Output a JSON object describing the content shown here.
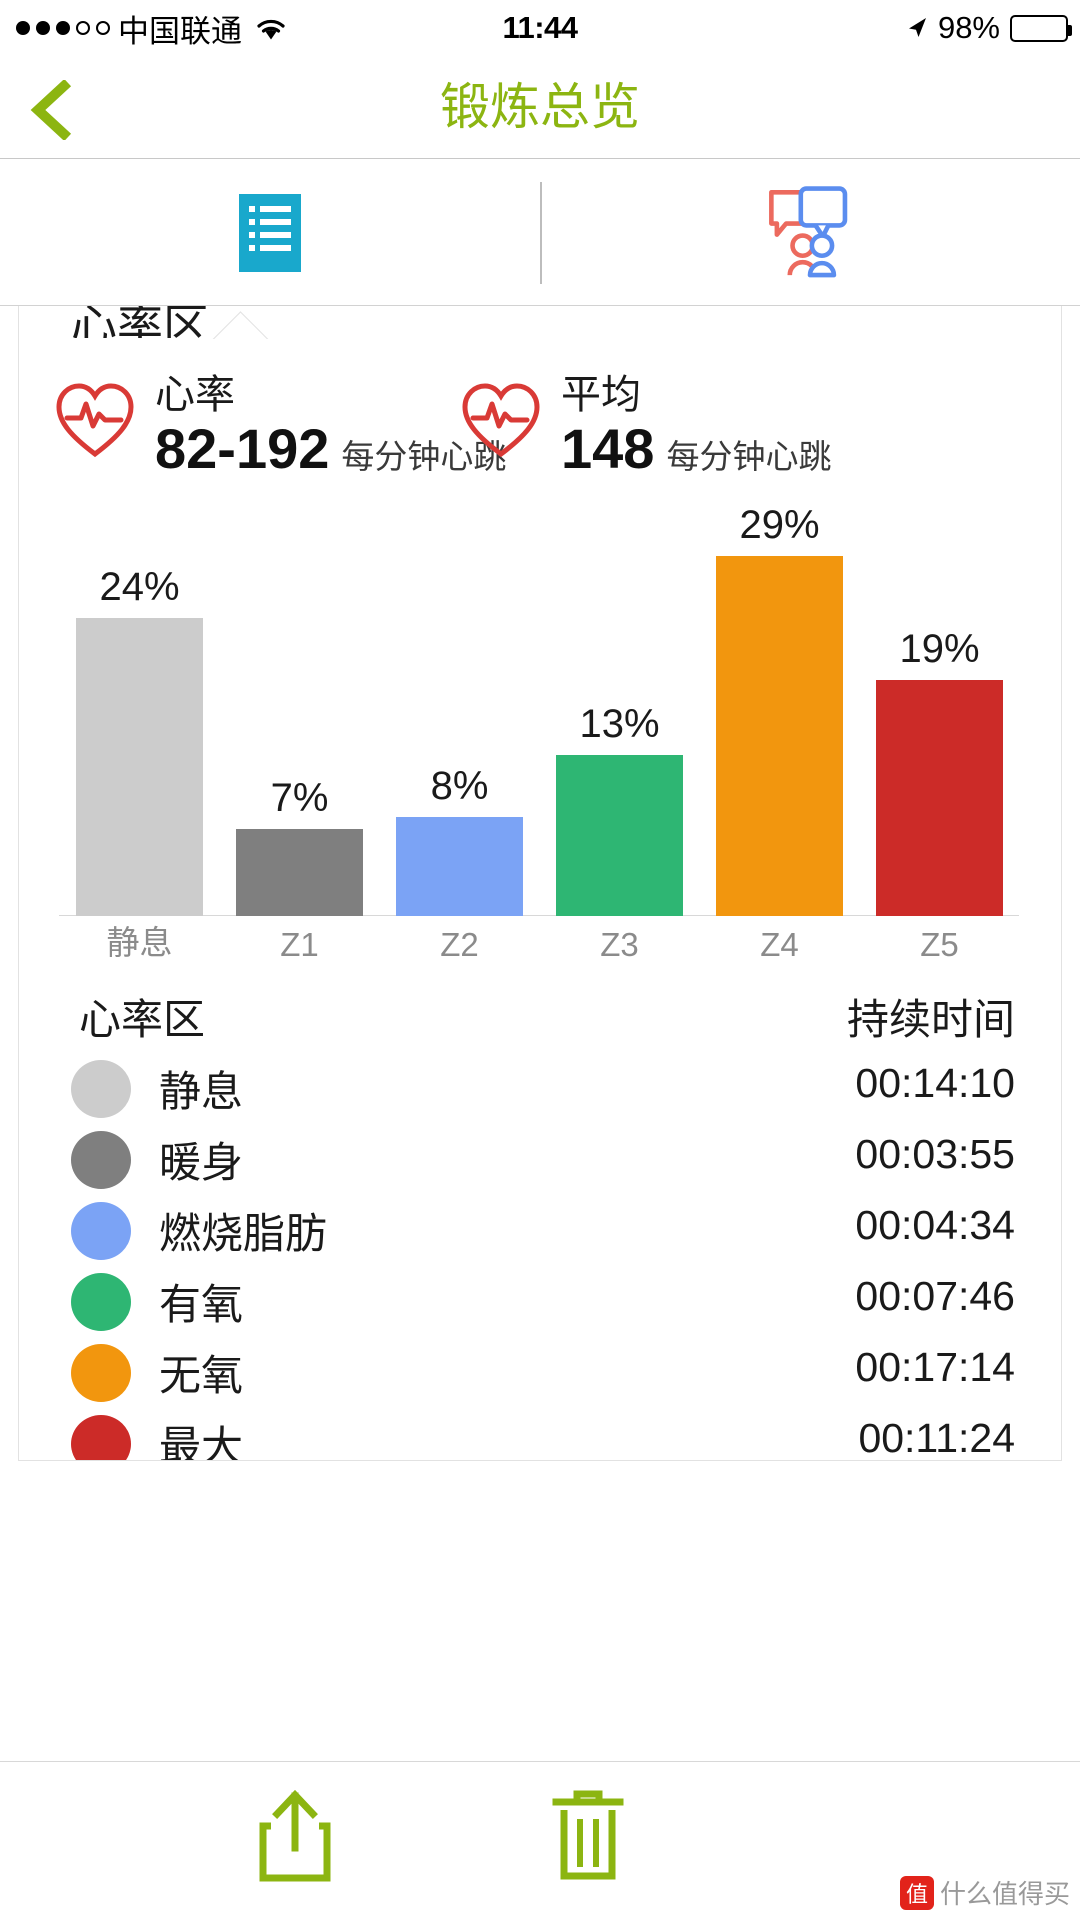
{
  "status_bar": {
    "carrier": "中国联通",
    "signal_filled_dots": 3,
    "signal_hollow_dots": 2,
    "wifi_icon": "wifi-icon",
    "time": "11:44",
    "location_icon": "location-arrow-icon",
    "battery_percent": "98%"
  },
  "nav": {
    "back_icon": "back-chevron-icon",
    "title": "锻炼总览",
    "accent_color": "#8CB511"
  },
  "tabs": [
    {
      "name": "summary",
      "icon": "list-icon",
      "active": true,
      "color": "#19A8CC"
    },
    {
      "name": "social",
      "icon": "chat-people-icon",
      "active": false,
      "colors": [
        "#EC6A5E",
        "#5B8DEF"
      ]
    }
  ],
  "card": {
    "section_title": "心率区",
    "stats": [
      {
        "icon": "heart-pulse-icon",
        "label": "心率",
        "value": "82-192",
        "unit": "每分钟心跳"
      },
      {
        "icon": "heart-pulse-icon",
        "label": "平均",
        "value": "148",
        "unit": "每分钟心跳"
      }
    ]
  },
  "chart_data": {
    "type": "bar",
    "title": "心率区",
    "xlabel": "",
    "ylabel": "",
    "ylim": [
      0,
      32
    ],
    "grid": false,
    "legend_position": "below-table",
    "categories": [
      "静息",
      "Z1",
      "Z2",
      "Z3",
      "Z4",
      "Z5"
    ],
    "values": [
      24,
      7,
      8,
      13,
      29,
      19
    ],
    "value_labels": [
      "24%",
      "7%",
      "8%",
      "13%",
      "29%",
      "19%"
    ],
    "colors": [
      "#CCCCCC",
      "#7F7F7F",
      "#7BA3F5",
      "#2EB673",
      "#F2960E",
      "#CC2B28"
    ],
    "zone_names": [
      "静息",
      "暖身",
      "燃烧脂肪",
      "有氧",
      "无氧",
      "最大"
    ],
    "durations": [
      "00:14:10",
      "00:03:55",
      "00:04:34",
      "00:07:46",
      "00:17:14",
      "00:11:24"
    ]
  },
  "table": {
    "header_zone": "心率区",
    "header_duration": "持续时间",
    "rows": [
      {
        "color": "#CCCCCC",
        "zone": "静息",
        "duration": "00:14:10"
      },
      {
        "color": "#7F7F7F",
        "zone": "暖身",
        "duration": "00:03:55"
      },
      {
        "color": "#7BA3F5",
        "zone": "燃烧脂肪",
        "duration": "00:04:34"
      },
      {
        "color": "#2EB673",
        "zone": "有氧",
        "duration": "00:07:46"
      },
      {
        "color": "#F2960E",
        "zone": "无氧",
        "duration": "00:17:14"
      },
      {
        "color": "#CC2B28",
        "zone": "最大",
        "duration": "00:11:24"
      }
    ]
  },
  "toolbar": {
    "share_icon": "share-upload-icon",
    "delete_icon": "trash-icon",
    "icon_color": "#8CB511"
  },
  "watermark": {
    "badge": "值",
    "text": "什么值得买"
  }
}
